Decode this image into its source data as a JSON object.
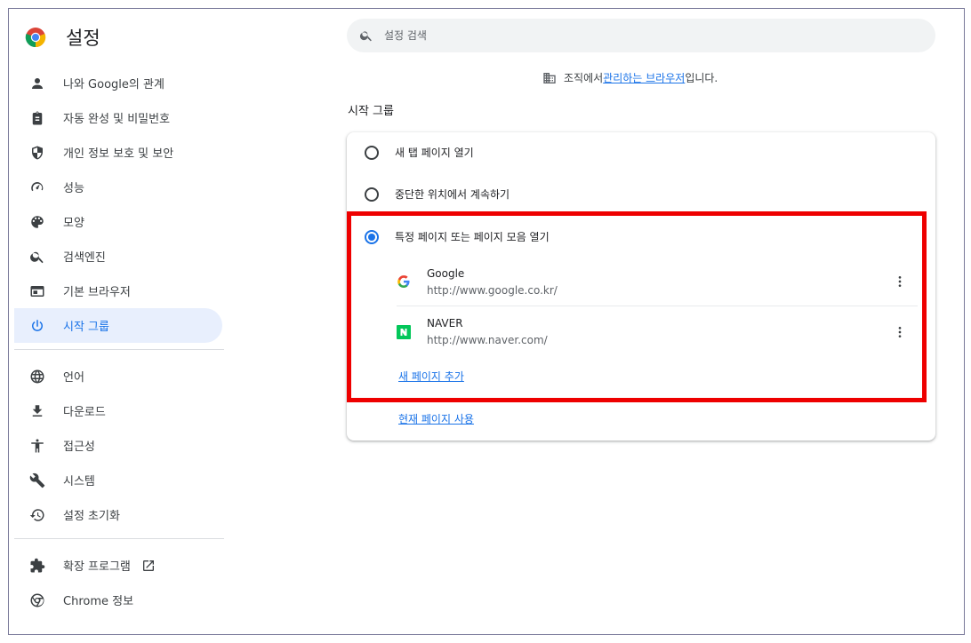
{
  "app": {
    "title": "설정"
  },
  "search": {
    "placeholder": "설정 검색"
  },
  "sidebar": {
    "items": [
      {
        "label": "나와 Google의 관계",
        "icon": "person-icon"
      },
      {
        "label": "자동 완성 및 비밀번호",
        "icon": "clipboard-icon"
      },
      {
        "label": "개인 정보 보호 및 보안",
        "icon": "shield-icon"
      },
      {
        "label": "성능",
        "icon": "speedometer-icon"
      },
      {
        "label": "모양",
        "icon": "palette-icon"
      },
      {
        "label": "검색엔진",
        "icon": "search-icon"
      },
      {
        "label": "기본 브라우저",
        "icon": "browser-icon"
      },
      {
        "label": "시작 그룹",
        "icon": "power-icon",
        "active": true
      }
    ],
    "items2": [
      {
        "label": "언어",
        "icon": "globe-icon"
      },
      {
        "label": "다운로드",
        "icon": "download-icon"
      },
      {
        "label": "접근성",
        "icon": "accessibility-icon"
      },
      {
        "label": "시스템",
        "icon": "wrench-icon"
      },
      {
        "label": "설정 초기화",
        "icon": "history-icon"
      }
    ],
    "items3": [
      {
        "label": "확장 프로그램",
        "icon": "puzzle-icon"
      },
      {
        "label": "Chrome 정보",
        "icon": "chrome-icon"
      }
    ]
  },
  "managed": {
    "prefix": "조직에서 ",
    "link": "관리하는 브라우저",
    "suffix": "입니다."
  },
  "startup": {
    "title": "시작 그룹",
    "options": [
      {
        "label": "새 탭 페이지 열기",
        "checked": false
      },
      {
        "label": "중단한 위치에서 계속하기",
        "checked": false
      },
      {
        "label": "특정 페이지 또는 페이지 모음 열기",
        "checked": true
      }
    ],
    "pages": [
      {
        "name": "Google",
        "url": "http://www.google.co.kr/",
        "icon": "google-icon"
      },
      {
        "name": "NAVER",
        "url": "http://www.naver.com/",
        "icon": "naver-icon"
      }
    ],
    "add_page": "새 페이지 추가",
    "use_current": "현재 페이지 사용"
  },
  "colors": {
    "accent": "#1a73e8",
    "active_bg": "#e8effd",
    "highlight": "#ee0000"
  }
}
